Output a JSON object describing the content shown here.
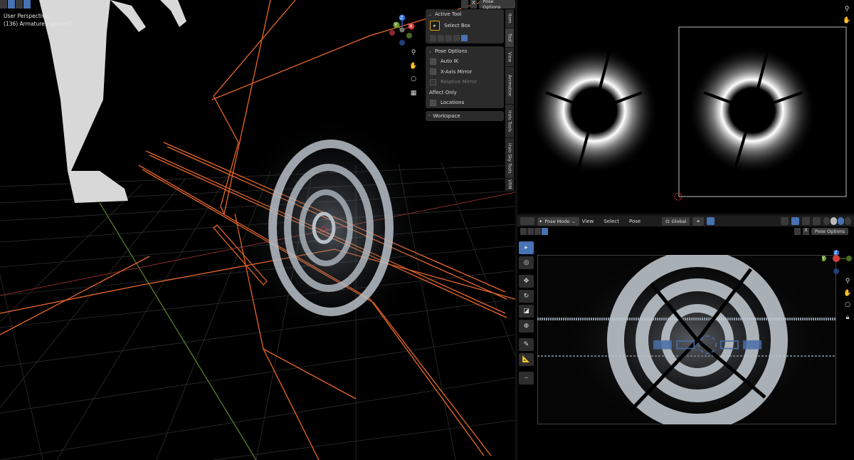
{
  "viewport3d": {
    "view_name": "User Perspective",
    "object_info": "(136) Armature : spinner5",
    "mode_button": "Pose Options",
    "gizmo": {
      "z": "Z",
      "y": "Y",
      "x": "X"
    }
  },
  "npanel": {
    "active_tool": {
      "header": "Active Tool",
      "tool_label": "Select Box"
    },
    "pose_options": {
      "header": "Pose Options",
      "auto_ik": "Auto IK",
      "x_axis_mirror": "X-Axis Mirror",
      "relative_mirror": "Relative Mirror",
      "affect_only": "Affect Only",
      "locations": "Locations"
    },
    "workspace": {
      "header": "Workspace"
    }
  },
  "tabs": [
    "Item",
    "Tool",
    "View",
    "Animation",
    "Halo Tools",
    "Halo Sky Tools",
    "VRM"
  ],
  "camera_view": {
    "mode_label": "Pose Mode",
    "menus": [
      "View",
      "Select",
      "Pose"
    ],
    "orientation": "Global",
    "pose_options_button": "Pose Options",
    "gizmo": {
      "z": "Z",
      "y": "Y"
    }
  },
  "colors": {
    "bg": "#000000",
    "panel": "#2b2b2b",
    "header": "#1d1d1d",
    "accent_blue": "#4772b3",
    "wire_orange": "#e8672a",
    "axis_red": "#d33a3a",
    "axis_green": "#6b9a2e",
    "axis_blue": "#2f6bd6"
  }
}
